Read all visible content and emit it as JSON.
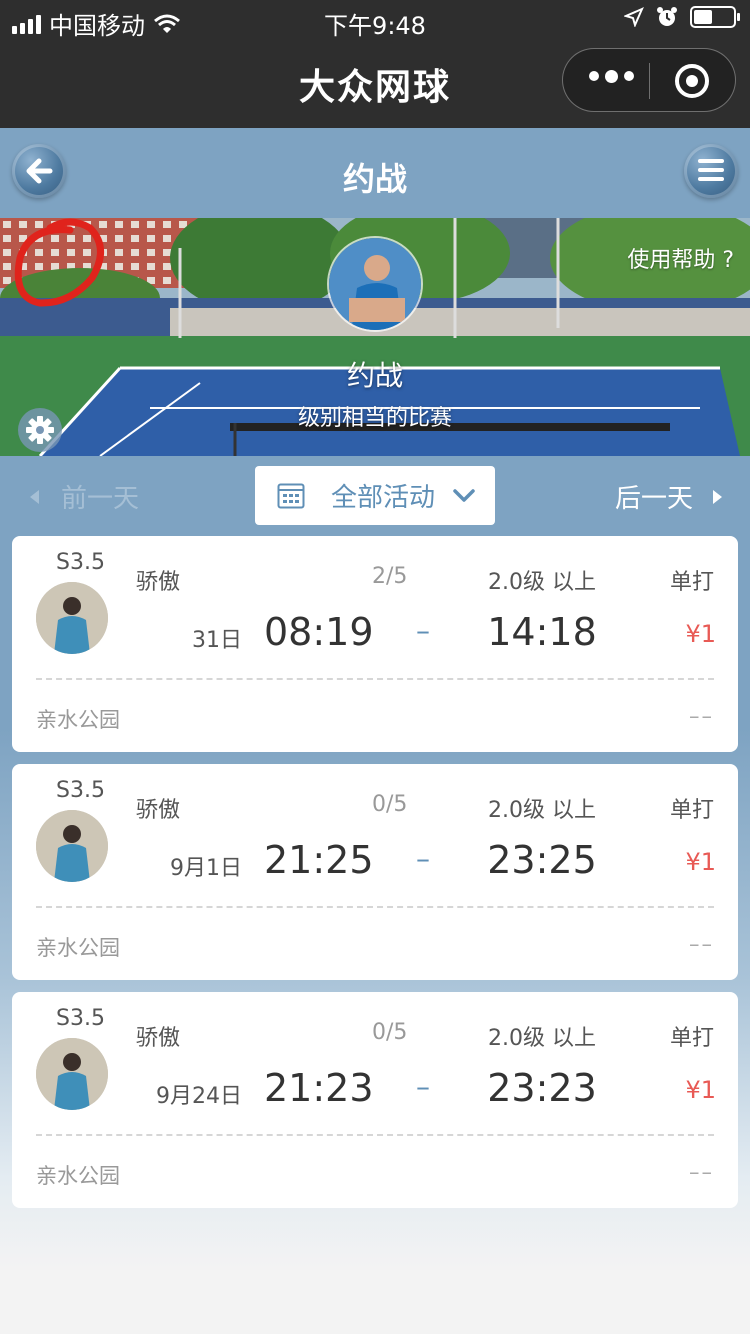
{
  "status_bar": {
    "carrier": "中国移动",
    "time": "下午9:48"
  },
  "app": {
    "title": "大众网球"
  },
  "header": {
    "title": "约战"
  },
  "banner": {
    "help": "使用帮助 ?",
    "title": "约战",
    "subtitle": "级别相当的比赛"
  },
  "day_nav": {
    "prev": "前一天",
    "filter": "全部活动",
    "next": "后一天"
  },
  "cards": [
    {
      "level": "S3.5",
      "user": "骄傲",
      "count": "2/5",
      "requirement": "2.0级 以上",
      "type": "单打",
      "date": "31日",
      "start": "08:19",
      "dash": "–",
      "end": "14:18",
      "price": "¥1",
      "location": "亲水公园",
      "extra": "––"
    },
    {
      "level": "S3.5",
      "user": "骄傲",
      "count": "0/5",
      "requirement": "2.0级 以上",
      "type": "单打",
      "date": "9月1日",
      "start": "21:25",
      "dash": "–",
      "end": "23:25",
      "price": "¥1",
      "location": "亲水公园",
      "extra": "––"
    },
    {
      "level": "S3.5",
      "user": "骄傲",
      "count": "0/5",
      "requirement": "2.0级 以上",
      "type": "单打",
      "date": "9月24日",
      "start": "21:23",
      "dash": "–",
      "end": "23:23",
      "price": "¥1",
      "location": "亲水公园",
      "extra": "––"
    }
  ],
  "colors": {
    "nav_bg": "#2e2e2e",
    "page_accent": "#7ea3c2",
    "price": "#e85a55",
    "link": "#5f8fb6"
  },
  "icons": [
    "signal-icon",
    "wifi-icon",
    "location-arrow-icon",
    "alarm-icon",
    "battery-icon",
    "more-dots-icon",
    "target-icon",
    "back-arrow-icon",
    "menu-icon",
    "settings-gear-icon",
    "calendar-icon",
    "chevron-down-icon",
    "triangle-left-icon",
    "triangle-right-icon"
  ]
}
